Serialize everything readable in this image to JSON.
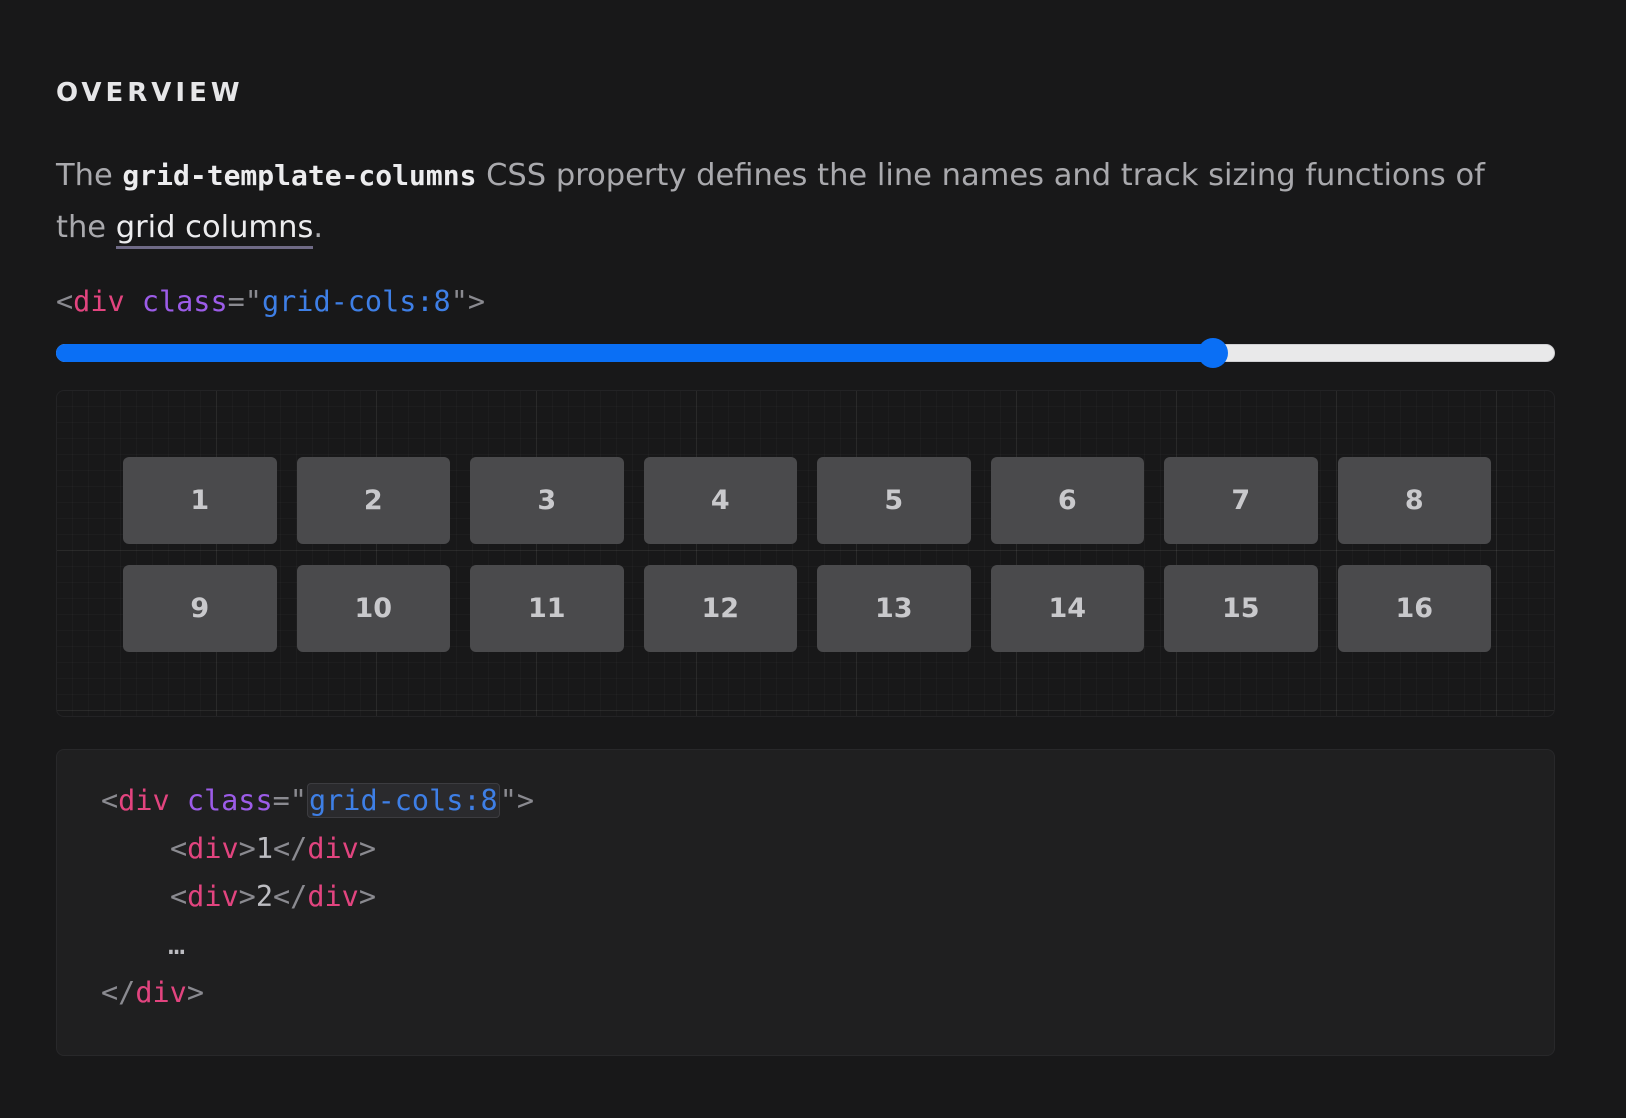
{
  "section_heading": "OVERVIEW",
  "description": {
    "prefix": "The ",
    "code_term": "grid-template-columns",
    "middle": " CSS property defines the line names and track sizing functions of the ",
    "link_text": "grid columns",
    "suffix": "."
  },
  "demo_tag": {
    "open_bracket": "<",
    "tag": "div",
    "attr": "class",
    "equals": "=",
    "quote": "\"",
    "value": "grid-cols:8",
    "close_bracket": ">"
  },
  "slider": {
    "value_fraction": 0.772,
    "fill_color": "#0a6ff5",
    "track_color": "#e9e9ea"
  },
  "grid_items": [
    "1",
    "2",
    "3",
    "4",
    "5",
    "6",
    "7",
    "8",
    "9",
    "10",
    "11",
    "12",
    "13",
    "14",
    "15",
    "16"
  ],
  "code_example": {
    "open_bracket": "<",
    "close_bracket": ">",
    "end_open": "</",
    "tag": "div",
    "attr": "class",
    "equals": "=",
    "quote": "\"",
    "class_value": "grid-cols:8",
    "child_1": "1",
    "child_2": "2",
    "ellipsis": "…"
  },
  "colors": {
    "background": "#181819",
    "tag": "#e2447f",
    "attribute": "#9c5ce8",
    "string": "#3e7fe6",
    "cell": "#4a4a4c"
  }
}
